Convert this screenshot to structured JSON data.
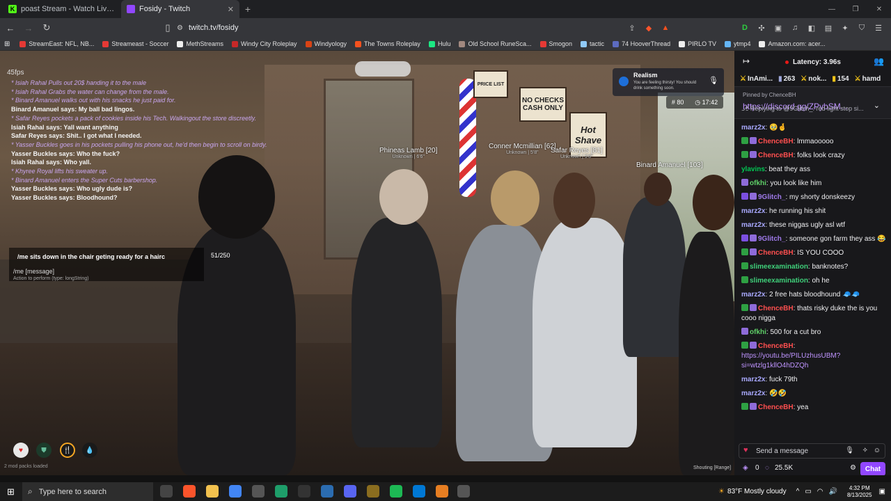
{
  "tabs": [
    {
      "title": "poast Stream - Watch Live on Kick",
      "favicon_color": "#53fc18",
      "favicon_text": "K",
      "active": false
    },
    {
      "title": "Fosidy - Twitch",
      "favicon_color": "#9147ff",
      "favicon_text": "",
      "active": true
    }
  ],
  "toolbar": {
    "url": "twitch.tv/fosidy"
  },
  "bookmarks": [
    {
      "label": "StreamEast: NFL, NB...",
      "color": "#e53935"
    },
    {
      "label": "Streameast - Soccer",
      "color": "#e53935"
    },
    {
      "label": "MethStreams",
      "color": "#eeeeee"
    },
    {
      "label": "Windy City Roleplay",
      "color": "#c62828"
    },
    {
      "label": "Windyology",
      "color": "#d84315"
    },
    {
      "label": "The Towns Roleplay",
      "color": "#f4511e"
    },
    {
      "label": "Hulu",
      "color": "#1ce783"
    },
    {
      "label": "Old School RuneSca...",
      "color": "#a1887f"
    },
    {
      "label": "Smogon",
      "color": "#e53935"
    },
    {
      "label": "tactic",
      "color": "#90caf9"
    },
    {
      "label": "74 HooverThread",
      "color": "#5c6bc0"
    },
    {
      "label": "PIRLO TV",
      "color": "#eeeeee"
    },
    {
      "label": "ytmp4",
      "color": "#64b5f6"
    },
    {
      "label": "Amazon.com: acer...",
      "color": "#eeeeee"
    }
  ],
  "game": {
    "fps": "45fps",
    "chatlog": [
      {
        "text": "* Isiah Rahal Pulls out 20$ handing it to the male",
        "kind": "me"
      },
      {
        "text": "* Isiah Rahal Grabs the water can change from the male.",
        "kind": "me"
      },
      {
        "text": "* Binard Amanuel walks out with his snacks he just paid for.",
        "kind": "me"
      },
      {
        "text": "Binard Amanuel says: My ball bad lingos.",
        "kind": "say"
      },
      {
        "text": "* Safar Reyes pockets a pack of cookies inside his Tech. Walkingout the store discreetly.",
        "kind": "me"
      },
      {
        "text": "Isiah Rahal says: Yall want anything",
        "kind": "say"
      },
      {
        "text": "Safar Reyes says: Shit.. I got what I needed.",
        "kind": "say"
      },
      {
        "text": "* Yasser Buckles goes in his pockets pulling his phone out, he'd then begin to scroll on birdy.",
        "kind": "me"
      },
      {
        "text": "Yasser Buckles says: Who the fuck?",
        "kind": "say"
      },
      {
        "text": "Isiah Rahal says: Who yall.",
        "kind": "say"
      },
      {
        "text": "* Khyree Royal lifts his sweater up.",
        "kind": "me"
      },
      {
        "text": "* Binard Amanuel enters the Super Cuts barbershop.",
        "kind": "me"
      },
      {
        "text": "Yasser Buckles says: Who ugly dude is?",
        "kind": "say"
      },
      {
        "text": "Yasser Buckles says: Bloodhound?",
        "kind": "say"
      }
    ],
    "nametags": [
      {
        "name": "Phineas Lamb [20]",
        "sub": "Unknown | 6'6\""
      },
      {
        "name": "Conner Mcmillian [62]",
        "sub": "Unknown | 5'8\""
      },
      {
        "name": "Safar Reyes [81]",
        "sub": "Unknown | 5'8\""
      },
      {
        "name": "Binard Amanuel [103]",
        "sub": ""
      }
    ],
    "command": {
      "input": "/me sits down in the chair geting ready for a hairc",
      "count": "51/250",
      "hint": "/me [message]",
      "hint_sub": "Action to perform (type: longString)"
    },
    "realism": {
      "title": "Realism",
      "sub": "You are feeling thirsty! You should drink something soon."
    },
    "stats": {
      "armor": "80",
      "time": "17:42"
    },
    "mods": "2 mod packs loaded",
    "voice": "Shouting [Range]",
    "signs": {
      "nochecks": "NO CHECKS CASH ONLY",
      "hot": "Hot Shave",
      "price": "PRICE LIST"
    }
  },
  "sidebar": {
    "latency": "Latency: 3.96s",
    "leaders": [
      {
        "name": "InAmi...",
        "color": "#efeff1"
      },
      {
        "name": "263",
        "color": "#efeff1"
      },
      {
        "name": "nok...",
        "color": "#efeff1"
      },
      {
        "name": "154",
        "color": "#efeff1"
      },
      {
        "name": "hamd",
        "color": "#efeff1"
      }
    ],
    "pinned_by": "Pinned by ChenceBH",
    "pinned_link": "https://discord.gg/ZPybSM...",
    "reply": "Replying to @9Glitch_: red light stop si...",
    "messages": [
      {
        "user": "marz2x",
        "color": "#a9a9ff",
        "badges": [],
        "text": "🥹🤞"
      },
      {
        "user": "ChenceBH",
        "color": "#ff4f4f",
        "badges": [
          "b-green",
          "b-sub"
        ],
        "text": "lmmaooooo"
      },
      {
        "user": "ChenceBH",
        "color": "#ff4f4f",
        "badges": [
          "b-green",
          "b-sub"
        ],
        "text": "folks look crazy"
      },
      {
        "user": "ylavins",
        "color": "#00c853",
        "badges": [],
        "text": "beat they ass"
      },
      {
        "user": "ofkhi",
        "color": "#5fd068",
        "badges": [
          "b-sub"
        ],
        "text": "you look like him"
      },
      {
        "user": "9Glitch_",
        "color": "#9f7aea",
        "badges": [
          "b-star",
          "b-sub"
        ],
        "text": "my shorty donskeezy"
      },
      {
        "user": "marz2x",
        "color": "#a9a9ff",
        "badges": [],
        "text": "he running his shit"
      },
      {
        "user": "marz2x",
        "color": "#a9a9ff",
        "badges": [],
        "text": "these niggas ugly asl wtf"
      },
      {
        "user": "9Glitch_",
        "color": "#9f7aea",
        "badges": [
          "b-star",
          "b-sub"
        ],
        "text": "someone gon farm they ass 😂"
      },
      {
        "user": "ChenceBH",
        "color": "#ff4f4f",
        "badges": [
          "b-green",
          "b-sub"
        ],
        "text": "IS YOU COOO"
      },
      {
        "user": "slimeexamination",
        "color": "#3fd07a",
        "badges": [
          "b-green"
        ],
        "text": "banknotes?"
      },
      {
        "user": "slimeexamination",
        "color": "#3fd07a",
        "badges": [
          "b-green"
        ],
        "text": "oh he"
      },
      {
        "user": "marz2x",
        "color": "#a9a9ff",
        "badges": [],
        "text": "2 free hats bloodhound 🧢🧢"
      },
      {
        "user": "ChenceBH",
        "color": "#ff4f4f",
        "badges": [
          "b-green",
          "b-sub"
        ],
        "text": "thats risky duke the is you cooo nigga"
      },
      {
        "user": "ofkhi",
        "color": "#5fd068",
        "badges": [
          "b-sub"
        ],
        "text": "500 for a cut bro"
      },
      {
        "user": "ChenceBH",
        "color": "#ff4f4f",
        "badges": [
          "b-green",
          "b-sub"
        ],
        "text": "",
        "link": "https://youtu.be/PILUzhusUBM?si=wtzlg1kllO4hDZQh"
      },
      {
        "user": "marz2x",
        "color": "#a9a9ff",
        "badges": [],
        "text": "fuck 79th"
      },
      {
        "user": "marz2x",
        "color": "#a9a9ff",
        "badges": [],
        "text": "🤣🤣"
      },
      {
        "user": "ChenceBH",
        "color": "#ff4f4f",
        "badges": [
          "b-green",
          "b-sub"
        ],
        "text": "yea"
      }
    ],
    "input_placeholder": "Send a message",
    "points": "0",
    "points2": "25.5K",
    "chat_button": "Chat"
  },
  "taskbar": {
    "search_placeholder": "Type here to search",
    "weather": "83°F  Mostly cloudy",
    "time": "4:32 PM",
    "date": "8/13/2025",
    "apps": [
      {
        "name": "task-view-icon",
        "color": "#444"
      },
      {
        "name": "brave-icon",
        "color": "#fb542b"
      },
      {
        "name": "explorer-icon",
        "color": "#f2c14e"
      },
      {
        "name": "chrome-icon",
        "color": "#4285f4"
      },
      {
        "name": "app-icon-1",
        "color": "#555"
      },
      {
        "name": "app-icon-2",
        "color": "#1e9e6a"
      },
      {
        "name": "capcut-icon",
        "color": "#333"
      },
      {
        "name": "app-icon-3",
        "color": "#2b6cb0"
      },
      {
        "name": "discord-icon",
        "color": "#5865f2"
      },
      {
        "name": "app-icon-4",
        "color": "#8a6d1f"
      },
      {
        "name": "spotify-icon",
        "color": "#1db954"
      },
      {
        "name": "skype-icon",
        "color": "#0078d4"
      },
      {
        "name": "app-icon-5",
        "color": "#e67e22"
      },
      {
        "name": "app-icon-6",
        "color": "#555"
      }
    ]
  }
}
